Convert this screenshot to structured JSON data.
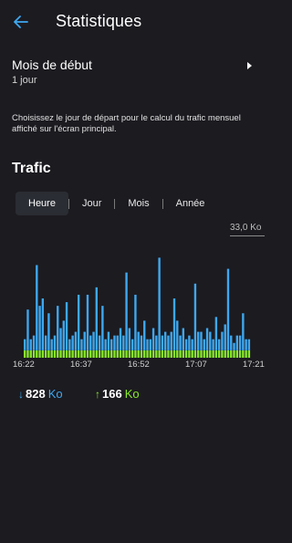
{
  "header": {
    "title": "Statistiques"
  },
  "start_month": {
    "label": "Mois de début",
    "value": "1 jour"
  },
  "help_text": "Choisissez le jour de départ pour le calcul du trafic mensuel affiché sur l'écran principal.",
  "traffic": {
    "title": "Trafic",
    "tabs": [
      "Heure",
      "Jour",
      "Mois",
      "Année"
    ],
    "active_tab": "Heure",
    "download": {
      "arrow": "↓",
      "value": "828",
      "unit": "Ko"
    },
    "upload": {
      "arrow": "↑",
      "value": "166",
      "unit": "Ko"
    }
  },
  "colors": {
    "download": "#3ea8f0",
    "upload": "#88e82a",
    "background": "#1c1b20"
  },
  "chart_data": {
    "type": "bar",
    "stacked": true,
    "ymax_label": "33,0 Ko",
    "ylim": [
      0,
      33
    ],
    "x_tick_labels": [
      "16:22",
      "16:37",
      "16:52",
      "17:07",
      "17:21"
    ],
    "series": [
      {
        "name": "Téléchargement",
        "values": [
          3,
          11,
          3,
          4,
          23,
          12,
          14,
          4,
          10,
          3,
          4,
          12,
          6,
          8,
          13,
          3,
          4,
          5,
          15,
          3,
          5,
          15,
          4,
          5,
          17,
          4,
          12,
          3,
          5,
          3,
          4,
          4,
          6,
          4,
          21,
          6,
          3,
          15,
          5,
          4,
          8,
          3,
          3,
          6,
          4,
          25,
          4,
          5,
          4,
          5,
          14,
          8,
          4,
          6,
          3,
          4,
          3,
          18,
          5,
          5,
          3,
          6,
          5,
          3,
          9,
          3,
          5,
          7,
          22,
          4,
          2,
          4,
          4,
          10,
          3,
          3
        ]
      },
      {
        "name": "Envoi",
        "values": [
          2,
          2,
          2,
          2,
          2,
          2,
          2,
          2,
          2,
          2,
          2,
          2,
          2,
          2,
          2,
          2,
          2,
          2,
          2,
          2,
          2,
          2,
          2,
          2,
          2,
          2,
          2,
          2,
          2,
          2,
          2,
          2,
          2,
          2,
          2,
          2,
          2,
          2,
          2,
          2,
          2,
          2,
          2,
          2,
          2,
          2,
          2,
          2,
          2,
          2,
          2,
          2,
          2,
          2,
          2,
          2,
          2,
          2,
          2,
          2,
          2,
          2,
          2,
          2,
          2,
          2,
          2,
          2,
          2,
          2,
          2,
          2,
          2,
          2,
          2,
          2
        ]
      }
    ]
  }
}
